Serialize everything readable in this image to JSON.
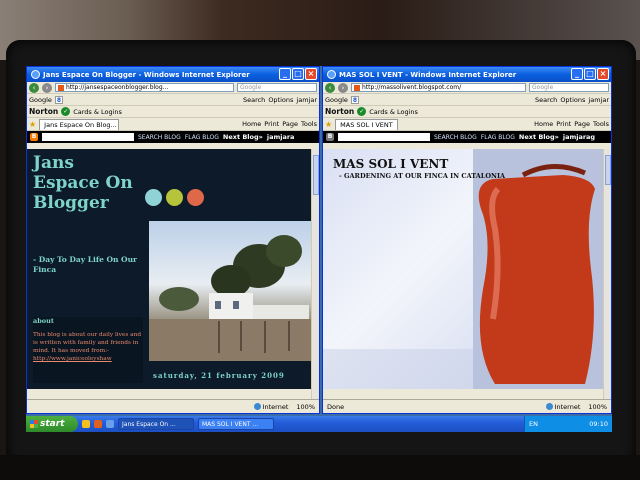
{
  "left_window": {
    "title": "Jans Espace On Blogger - Windows Internet Explorer",
    "address": "http://jansespaceonblogger.blog...",
    "search_placeholder": "Google",
    "google_toolbar": "Google",
    "search_label": "Search",
    "options_label": "Options",
    "user_label": "jamjar",
    "norton": "Norton",
    "cards_logins": "Cards & Logins",
    "tab_title": "Jans Espace On Blog...",
    "home": "Home",
    "print": "Print",
    "page": "Page",
    "tools": "Tools",
    "blogger": {
      "search_blog": "SEARCH BLOG",
      "flag_blog": "FLAG BLOG",
      "next_blog": "Next Blog»",
      "user": "jamjara"
    },
    "blog": {
      "title": "Jans Espace On Blogger",
      "subtitle": "- Day To Day Life On Our Finca",
      "about_heading": "about",
      "about_text": "This blog is about our daily lives and is written with family and friends in mind. It has moved from:-",
      "about_link": "http://www.janiceoleyshaw",
      "date": "saturday, 21 february 2009"
    },
    "status": {
      "zone": "Internet",
      "zoom": "100%"
    }
  },
  "right_window": {
    "title": "MAS SOL I VENT - Windows Internet Explorer",
    "address": "http://massolivent.blogspot.com/",
    "search_placeholder": "Google",
    "google_toolbar": "Google",
    "search_label": "Search",
    "options_label": "Options",
    "user_label": "jamjar",
    "norton": "Norton",
    "cards_logins": "Cards & Logins",
    "tab_title": "MAS SOL I VENT",
    "home": "Home",
    "print": "Print",
    "page": "Page",
    "tools": "Tools",
    "blogger": {
      "search_blog": "SEARCH BLOG",
      "flag_blog": "FLAG BLOG",
      "next_blog": "Next Blog»",
      "user": "jamjarag"
    },
    "blog": {
      "title": "MAS SOL I VENT",
      "subtitle": "- GARDENING AT OUR FINCA IN CATALONIA"
    },
    "status": {
      "done": "Done",
      "zone": "Internet",
      "zoom": "100%"
    }
  },
  "taskbar": {
    "start": "start",
    "tasks": [
      "Jans Espace On ...",
      "MAS SOL I VENT ..."
    ],
    "language": "EN",
    "clock": "09:10"
  },
  "colors": {
    "dot_1": "#8fd3d6",
    "dot_2": "#b5c43a",
    "dot_3": "#e0684a",
    "accent_title": "#7fd4c8",
    "about_text": "#e88a6a",
    "xp_blue": "#245edb"
  }
}
